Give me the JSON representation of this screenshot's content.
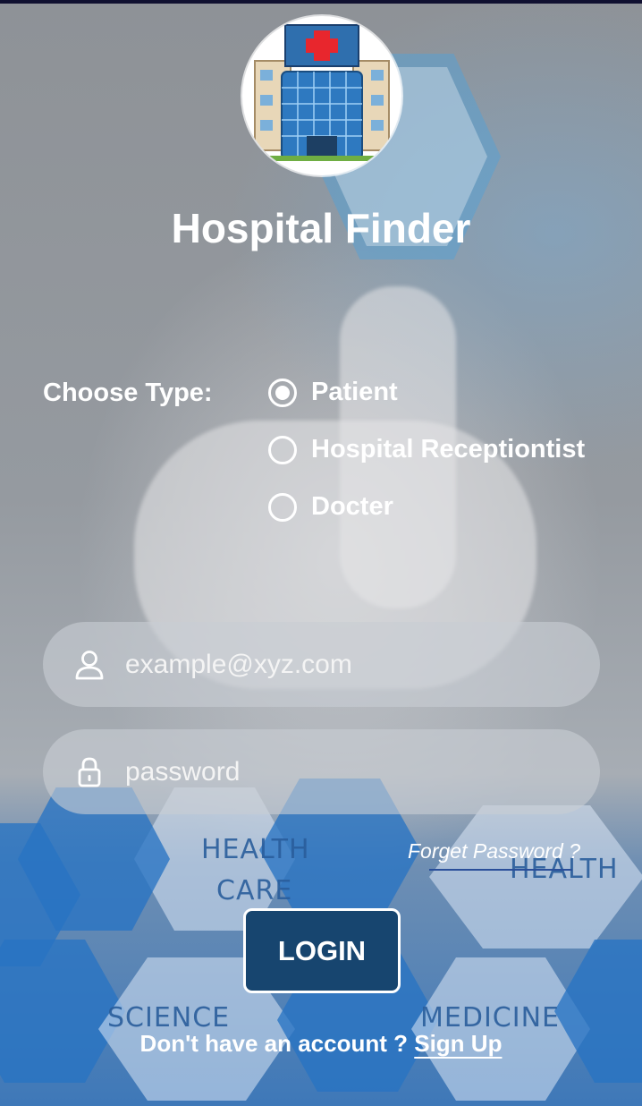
{
  "app": {
    "title": "Hospital Finder",
    "logo_icon": "hospital-building-icon"
  },
  "background": {
    "hex_labels": [
      "HEALTH",
      "CARE",
      "HEALTH",
      "SCIENCE",
      "MEDICINE"
    ]
  },
  "user_type": {
    "label": "Choose Type:",
    "options": [
      {
        "label": "Patient",
        "selected": true
      },
      {
        "label": "Hospital Receptiontist",
        "selected": false
      },
      {
        "label": "Docter",
        "selected": false
      }
    ]
  },
  "form": {
    "email": {
      "placeholder": "example@xyz.com",
      "value": "",
      "icon": "user-icon"
    },
    "password": {
      "placeholder": "password",
      "value": "",
      "icon": "lock-icon"
    },
    "forget_password": "Forget Password ?",
    "login_label": "LOGIN"
  },
  "signup": {
    "prompt": "Don't have an account ?",
    "link": "Sign Up"
  },
  "colors": {
    "login_button": "#17456f",
    "text": "#ffffff",
    "hex_blue": "#2873c3"
  }
}
